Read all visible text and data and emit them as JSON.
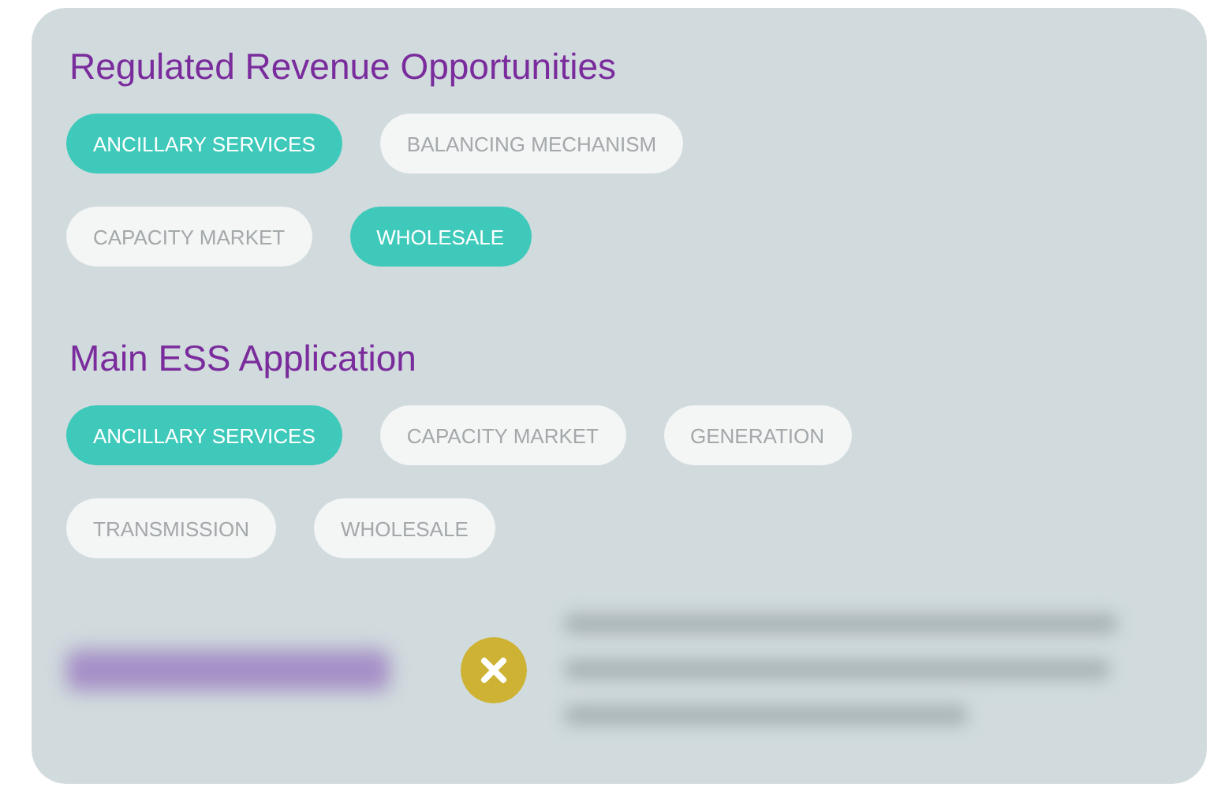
{
  "sections": [
    {
      "title": "Regulated Revenue Opportunities",
      "options": [
        {
          "label": "ANCILLARY SERVICES",
          "selected": true
        },
        {
          "label": "BALANCING MECHANISM",
          "selected": false
        },
        {
          "label": "CAPACITY MARKET",
          "selected": false
        },
        {
          "label": "WHOLESALE",
          "selected": true
        }
      ]
    },
    {
      "title": "Main ESS Application",
      "options": [
        {
          "label": "ANCILLARY SERVICES",
          "selected": true
        },
        {
          "label": "CAPACITY MARKET",
          "selected": false
        },
        {
          "label": "GENERATION",
          "selected": false
        },
        {
          "label": "TRANSMISSION",
          "selected": false
        },
        {
          "label": "WHOLESALE",
          "selected": false
        }
      ]
    }
  ]
}
